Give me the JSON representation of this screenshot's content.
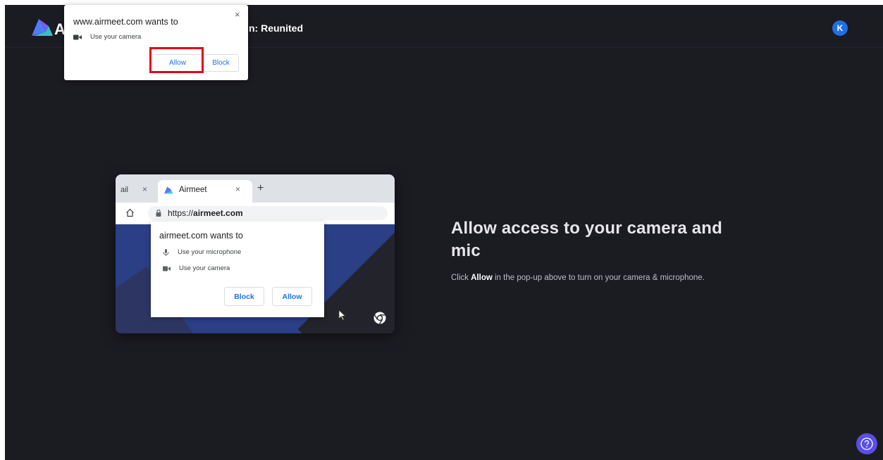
{
  "header": {
    "logo_letter": "A",
    "event_title": "n: Reunited",
    "avatar_initial": "K"
  },
  "browser_prompt": {
    "title": "www.airmeet.com wants to",
    "permission": "Use your camera",
    "allow_label": "Allow",
    "block_label": "Block",
    "close_label": "×"
  },
  "illustration": {
    "prev_tab_label": "ail",
    "tab_close": "×",
    "active_tab_label": "Airmeet",
    "new_tab": "+",
    "url_prefix": "https://",
    "url_domain": "airmeet.com",
    "popup": {
      "title": "airmeet.com wants to",
      "permission_mic": "Use your microphone",
      "permission_camera": "Use your camera",
      "block_label": "Block",
      "allow_label": "Allow"
    }
  },
  "main": {
    "heading": "Allow access to your camera and mic",
    "desc_before": "Click ",
    "desc_bold": "Allow",
    "desc_after": " in the pop-up above to turn on your camera & microphone."
  },
  "colors": {
    "background": "#1b1b22",
    "accent_blue": "#1a73e8",
    "highlight_red": "#e0001b",
    "help_purple": "#5a4ee6"
  }
}
